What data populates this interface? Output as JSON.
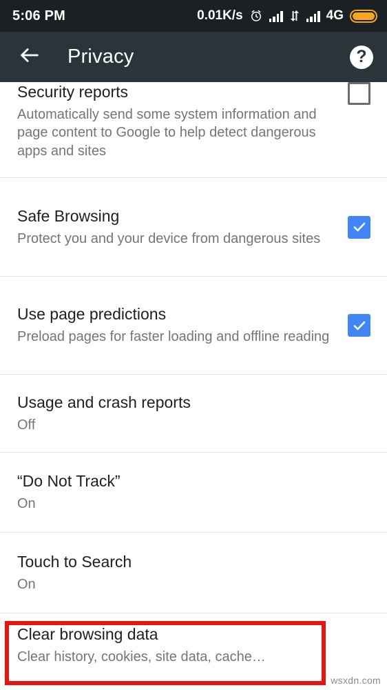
{
  "status_bar": {
    "time": "5:06 PM",
    "net_speed": "0.01K/s",
    "alarm_icon": "alarm-clock-icon",
    "signal_icon_1": "signal-bars-icon",
    "data_arrows_icon": "data-transfer-arrows-icon",
    "signal_icon_2": "signal-bars-icon",
    "network_type": "4G",
    "battery_icon": "battery-full-icon",
    "background_color": "#1b2023"
  },
  "app_bar": {
    "back_icon": "back-arrow-icon",
    "title": "Privacy",
    "help_label": "?",
    "background_color": "#2a343b"
  },
  "settings": {
    "items": [
      {
        "title": "Security reports",
        "summary": "Automatically send some system information and page content to Google to help detect dangerous apps and sites",
        "control": "checkbox",
        "checked": false
      },
      {
        "title": "Safe Browsing",
        "summary": "Protect you and your device from dangerous sites",
        "control": "checkbox",
        "checked": true
      },
      {
        "title": "Use page predictions",
        "summary": "Preload pages for faster loading and offline reading",
        "control": "checkbox",
        "checked": true
      },
      {
        "title": "Usage and crash reports",
        "summary": "Off",
        "control": "none"
      },
      {
        "title": "“Do Not Track”",
        "summary": "On",
        "control": "none"
      },
      {
        "title": "Touch to Search",
        "summary": "On",
        "control": "none"
      },
      {
        "title": "Clear browsing data",
        "summary": "Clear history, cookies, site data, cache…",
        "control": "none",
        "highlighted": true
      }
    ]
  },
  "annotation": {
    "highlight_color": "#e8140f"
  },
  "watermark": {
    "text": "wsxdn.com"
  },
  "colors": {
    "accent": "#4285f4",
    "title_text": "#1f1f1f",
    "summary_text": "#757575",
    "divider": "#e3e3e3"
  }
}
